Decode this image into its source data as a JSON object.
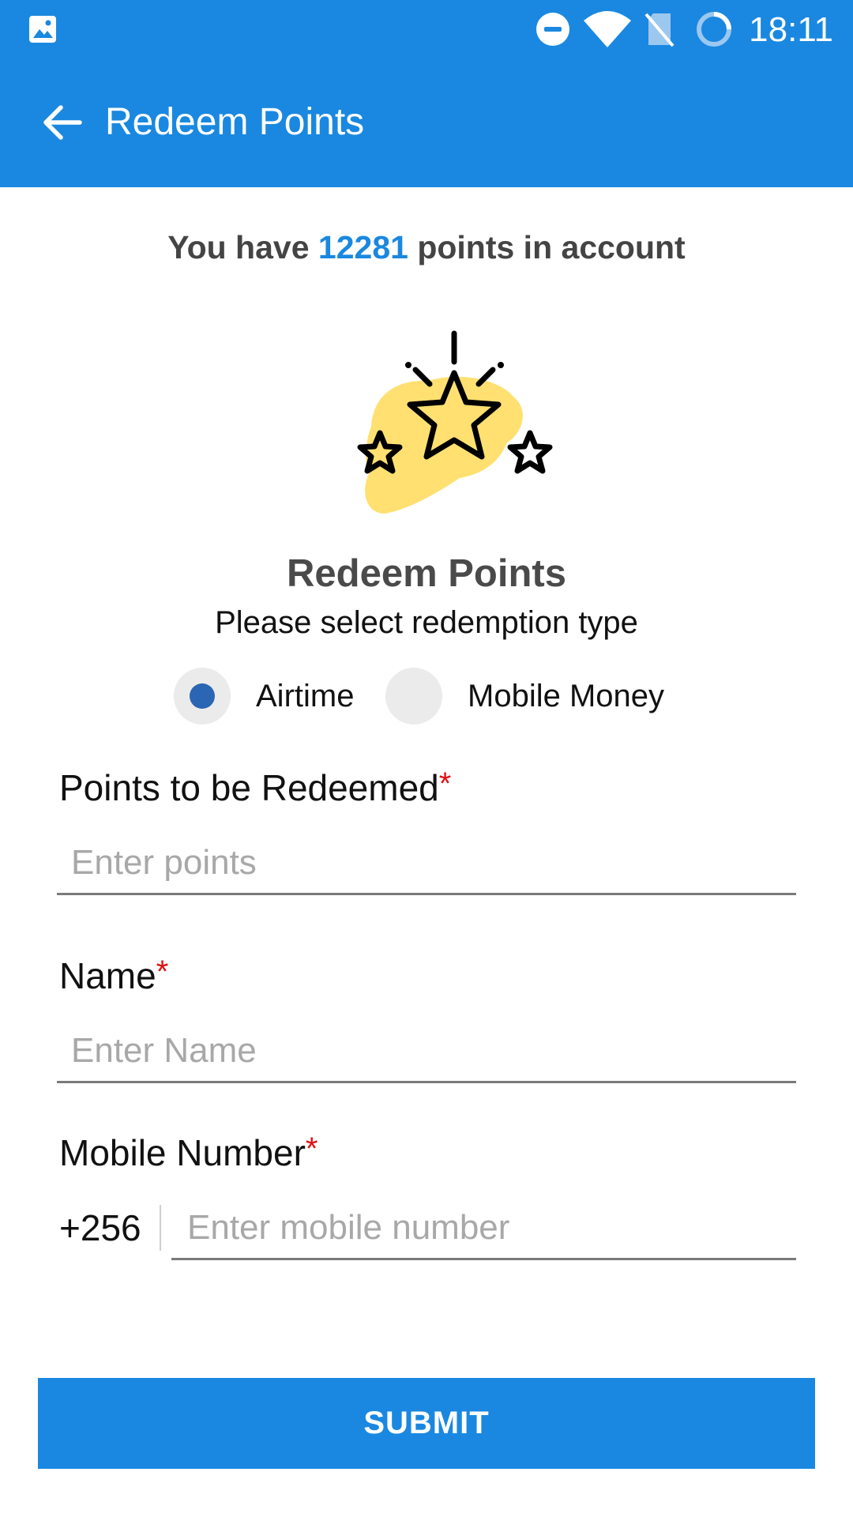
{
  "status_bar": {
    "time": "18:11",
    "icons": [
      "image-icon",
      "do-not-disturb-icon",
      "wifi-icon",
      "no-sim-icon",
      "loading-icon"
    ]
  },
  "app_bar": {
    "back_icon": "arrow-back-icon",
    "title": "Redeem Points"
  },
  "summary": {
    "prefix": "You have ",
    "points": "12281",
    "suffix": " points in account"
  },
  "illustration": {
    "icon": "stars-icon",
    "accent_color": "#FFE070"
  },
  "section": {
    "title": "Redeem Points",
    "subtitle": "Please select redemption type"
  },
  "redemption_types": [
    {
      "label": "Airtime",
      "selected": true
    },
    {
      "label": "Mobile Money",
      "selected": false
    }
  ],
  "form": {
    "points": {
      "label": "Points to be Redeemed",
      "required_mark": "*",
      "placeholder": "Enter points",
      "value": ""
    },
    "name": {
      "label": "Name",
      "required_mark": "*",
      "placeholder": "Enter Name",
      "value": ""
    },
    "mobile": {
      "label": "Mobile Number",
      "required_mark": "*",
      "prefix": "+256",
      "placeholder": "Enter mobile number",
      "value": ""
    }
  },
  "submit_label": "SUBMIT",
  "colors": {
    "primary": "#1A88E0",
    "radio_selected": "#2A66B3",
    "required": "#E01010"
  }
}
